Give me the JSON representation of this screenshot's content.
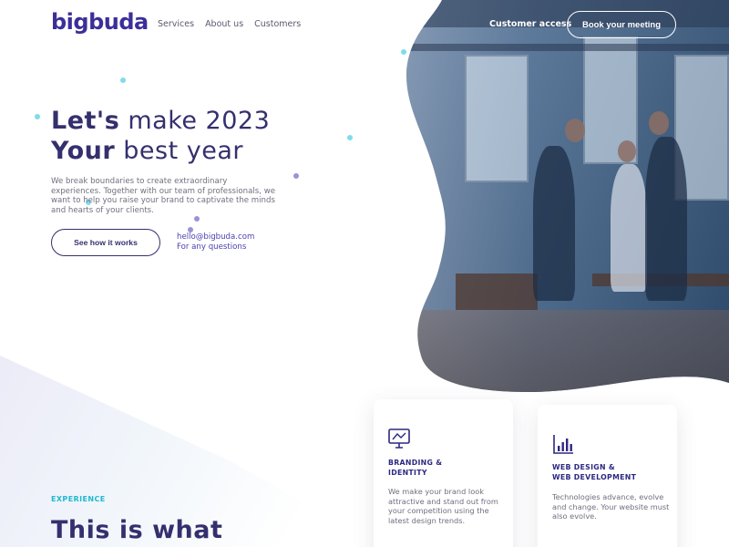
{
  "brand": {
    "logo_text": "bigbuda",
    "color": "#3b2f9a"
  },
  "nav": {
    "left_items": [
      {
        "label": "Services"
      },
      {
        "label": "About us"
      },
      {
        "label": "Customers"
      }
    ],
    "customer_access": "Customer access",
    "book_meeting": "Book your meeting"
  },
  "hero": {
    "line1_bold": "Let's",
    "line1_rest": " make 2023",
    "line2_bold": "Your",
    "line2_rest": " best year",
    "intro": "We break boundaries to create extraordinary experiences. Together with our team of professionals, we want to help you raise your brand to captivate the minds and hearts of your clients.",
    "cta": "See how it works",
    "email": "hello@bigbuda.com",
    "email_note": "For any questions"
  },
  "experience": {
    "label": "EXPERIENCE",
    "heading_bold": "This",
    "heading_rest": " is what"
  },
  "cards": [
    {
      "icon": "monitor-icon",
      "title_line1": "BRANDING &",
      "title_line2": "IDENTITY",
      "text": "We make your brand look attractive and stand out from your competition using the latest design trends."
    },
    {
      "icon": "bar-chart-icon",
      "title_line1": "WEB DESIGN &",
      "title_line2": "WEB DEVELOPMENT",
      "text": "Technologies advance, evolve and change. Your website must also evolve."
    }
  ],
  "colors": {
    "primary": "#34306e",
    "accent_cyan": "#1fb8cf",
    "accent_purple": "#8e86d6"
  }
}
